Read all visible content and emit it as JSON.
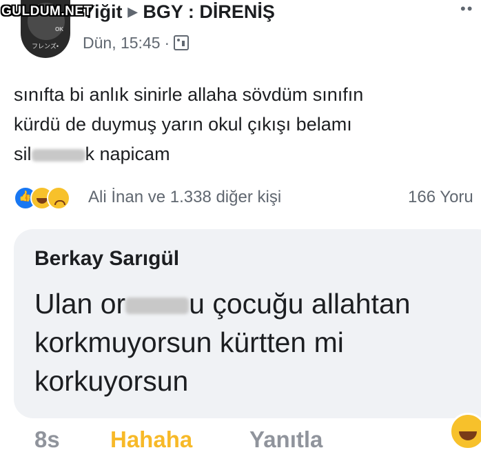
{
  "watermark": "GULDUM.NET",
  "header": {
    "poster_name": "Yiğit",
    "group_name": "BGY : DİRENİŞ",
    "timestamp": "Dün, 15:45",
    "separator": "·",
    "avatar_tag": "フレンズ•",
    "avatar_badge": "OK",
    "privacy_icon": "group-icon",
    "more_icon": "more-dots-icon",
    "more": "••"
  },
  "post": {
    "line1": "sınıfta bi anlık sinirle allaha sövdüm sınıfın",
    "line2": "kürdü de duymuş yarın okul çıkışı belamı",
    "line3_start": "sil",
    "line3_end": "k napicam"
  },
  "reactions": {
    "icons": [
      "like-icon",
      "haha-icon",
      "sad-icon"
    ],
    "text": "Ali İnan ve 1.338 diğer kişi",
    "comment_count": "166 Yoru"
  },
  "comment": {
    "author": "Berkay Sarıgül",
    "line1_start": "Ulan or",
    "line1_end": "u çocuğu allahtan",
    "line2": "korkmuyorsun kürtten mi",
    "line3": "korkuyorsun",
    "time": "8s",
    "reaction_label": "Hahaha",
    "reply_label": "Yanıtla",
    "reaction_icon": "haha-icon"
  },
  "colors": {
    "text": "#1c1e21",
    "meta": "#606770",
    "like_blue": "#1877f2",
    "haha_yellow": "#f7b928",
    "bubble_bg": "#f0f2f5"
  }
}
